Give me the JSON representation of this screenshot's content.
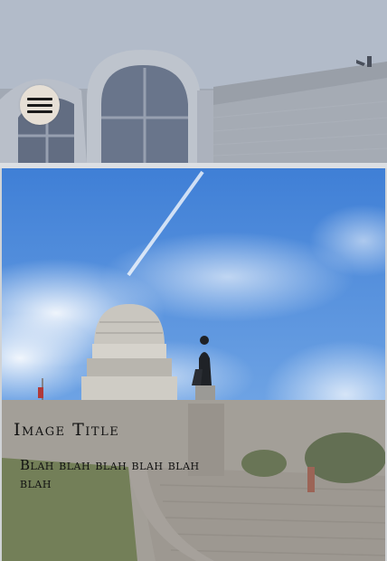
{
  "header": {
    "menu_icon": "hamburger-menu-icon"
  },
  "card": {
    "title": "Image Title",
    "body": "Blah blah blah blah blah blah"
  },
  "colors": {
    "menu_button_bg": "#e6dfd5",
    "caption_overlay": "#78736e",
    "sky": "#4a86d8"
  }
}
